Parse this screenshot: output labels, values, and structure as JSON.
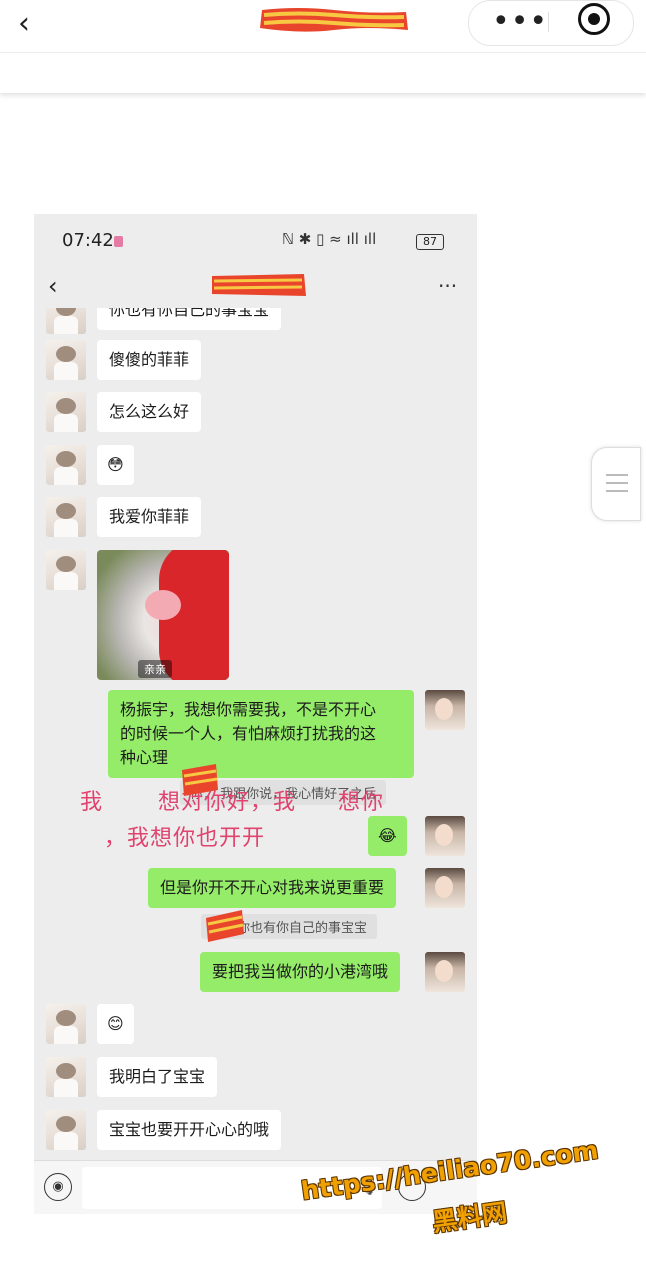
{
  "outer_header": {
    "back_glyph": "‹",
    "title_icon": "redacted-title",
    "more_glyph": "•••",
    "target_icon": "target-icon"
  },
  "status_bar": {
    "time": "07:42",
    "icons_text": "ℕ ✱ ▯ ≈ ıll ıll",
    "battery": "87"
  },
  "chat_header": {
    "back_glyph": "‹",
    "more_glyph": "···"
  },
  "messages": {
    "m0": "你也有你自己的事宝宝",
    "m1": "傻傻的菲菲",
    "m2": "怎么这么好",
    "m3_emoji": "😳",
    "m4": "我爱你菲菲",
    "sticker_caption": "亲亲",
    "m5": "杨振宇，我想你需要我，不是不开心\n的时候一个人，有怕麻烦打扰我的这\n种心理",
    "quote1": "你：  我跟你说，我心情好了之后",
    "m6_emoji": "😂",
    "m7": "但是你开不开心对我来说更重要",
    "quote2": "宇：你也有你自己的事宝宝",
    "m8": "要把我当做你的小港湾哦",
    "m9_emoji": "😊",
    "m10": "我明白了宝宝",
    "m11": "宝宝也要开开心心的哦"
  },
  "overlay": {
    "line1_a": "我",
    "line1_b": "想对你好，我",
    "line1_c": "想你",
    "line2": "，我想你也开开"
  },
  "input_bar": {
    "voice_glyph": "◉",
    "mic_glyph": "🎙"
  },
  "watermark": {
    "url": "https://heiliao70.com",
    "name": "黑料网"
  },
  "colors": {
    "bubble_right": "#95ec69",
    "bubble_left": "#ffffff",
    "chat_bg": "#ededed",
    "overlay_text": "#e0436e",
    "watermark": "#f0a000"
  }
}
